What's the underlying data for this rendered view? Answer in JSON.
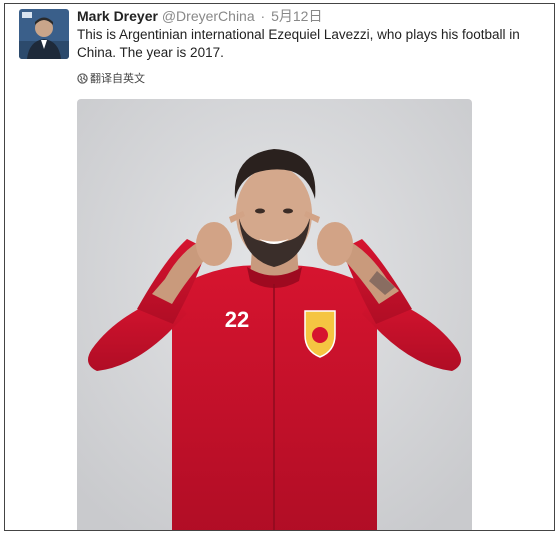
{
  "tweet": {
    "author_name": "Mark Dreyer",
    "author_handle": "@DreyerChina",
    "separator": "·",
    "date": "5月12日",
    "text": "This is Argentinian international Ezequiel Lavezzi, who plays his football in China. The year is 2017.",
    "translate_label": "翻译自英文",
    "translate_icon": "globe-icon"
  },
  "photo": {
    "jersey_number": "22",
    "jersey_color": "#c8102e",
    "background_color": "#d7d8da"
  }
}
